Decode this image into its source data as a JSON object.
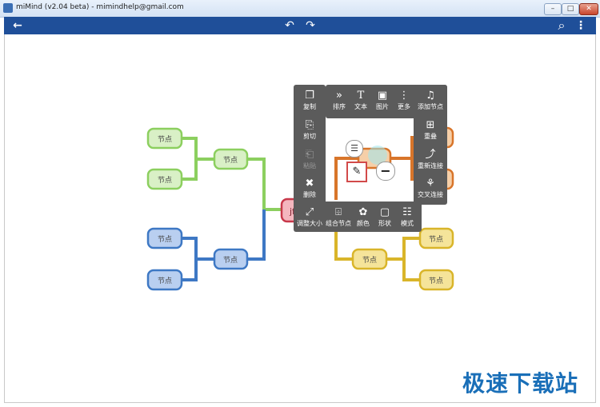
{
  "window": {
    "title": "miMind (v2.04 beta) - mimindhelp@gmail.com",
    "controls": [
      "–",
      "□",
      "✕"
    ]
  },
  "toolbar": {
    "back_icon": "←",
    "undo_icon": "↶",
    "redo_icon": "↷",
    "search_icon": "⌕",
    "more_icon": "⋮"
  },
  "mindmap": {
    "root_label": "jf",
    "left_green": {
      "parent": "节点",
      "children": [
        "节点",
        "节点"
      ]
    },
    "left_blue": {
      "parent": "节点",
      "children": [
        "节点",
        "节点"
      ]
    },
    "right_yellow": {
      "parent": "节点",
      "children": [
        "节点",
        "节点"
      ]
    },
    "colors": {
      "green": "#8ccf5f",
      "green_fill": "#d9f0c6",
      "blue": "#3e78c4",
      "blue_fill": "#b9cff0",
      "yellow": "#d9b52a",
      "yellow_fill": "#f5e49a",
      "orange": "#d8752a",
      "orange_fill": "#f6cfa8",
      "root": "#c8384a",
      "root_fill": "#f4b6be"
    }
  },
  "context_menu": {
    "left": [
      {
        "label": "复制",
        "icon": "❐"
      },
      {
        "label": "剪切",
        "icon": "⎘"
      },
      {
        "label": "粘贴",
        "icon": "⎗"
      },
      {
        "label": "删除",
        "icon": "✖"
      }
    ],
    "top": [
      {
        "label": "排序",
        "icon": "»"
      },
      {
        "label": "文本",
        "icon": "T"
      },
      {
        "label": "图片",
        "icon": "▣"
      },
      {
        "label": "更多",
        "icon": "⋮"
      }
    ],
    "right": [
      {
        "label": "添加节点",
        "icon": "♫"
      },
      {
        "label": "重叠",
        "icon": "⊞"
      },
      {
        "label": "重新连接",
        "icon": "⤴"
      },
      {
        "label": "交叉连接",
        "icon": "⚘"
      }
    ],
    "bottom": [
      {
        "label": "调整大小",
        "icon": "⤢"
      },
      {
        "label": "组合节点",
        "icon": "⌹"
      },
      {
        "label": "颜色",
        "icon": "✿"
      },
      {
        "label": "形状",
        "icon": "▢"
      },
      {
        "label": "模式",
        "icon": "☷"
      }
    ],
    "inner": {
      "edit_icon": "✎",
      "minus_icon": "−",
      "note_icon": "☰"
    }
  },
  "watermark": "极速下载站"
}
